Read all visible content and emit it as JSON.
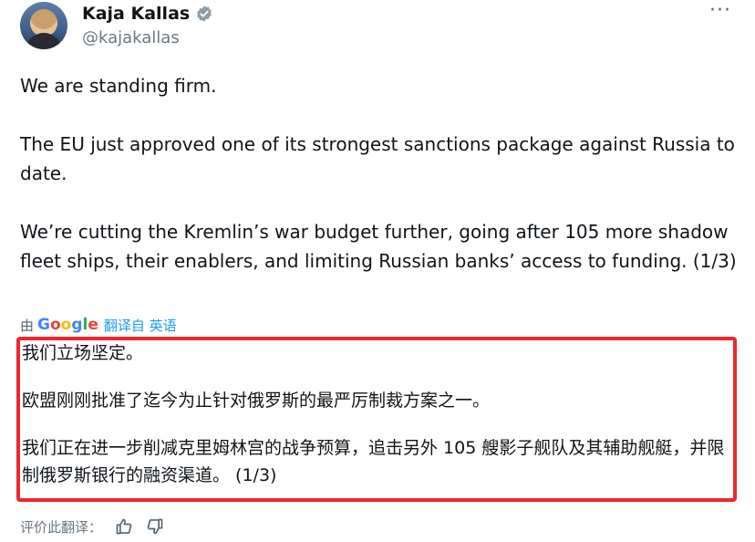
{
  "author": {
    "display_name": "Kaja Kallas",
    "handle": "@kajakallas",
    "avatar_icon": "avatar",
    "verified_icon": "verified-badge-icon"
  },
  "more_menu": {
    "label": "···"
  },
  "tweet": {
    "paragraphs": [
      "We are standing firm.",
      "The EU just approved one of its strongest sanctions package against Russia to date.",
      "We’re cutting the Kremlin’s war budget further, going after 105 more shadow fleet ships, their enablers, and limiting Russian banks’ access to funding. (1/3)"
    ]
  },
  "translation": {
    "prefix": "由",
    "provider": "Google",
    "link_text": "翻译自 英语",
    "paragraphs": [
      "我们立场坚定。",
      "欧盟刚刚批准了迄今为止针对俄罗斯的最严厉制裁方案之一。",
      "我们正在进一步削减克里姆林宫的战争预算，追击另外 105 艘影子舰队及其辅助舰艇，并限制俄罗斯银行的融资渠道。 (1/3)"
    ],
    "highlight_color": "#e8292f"
  },
  "rating": {
    "label": "评价此翻译：",
    "thumbs_up_icon": "thumbs-up-icon",
    "thumbs_down_icon": "thumbs-down-icon"
  },
  "colors": {
    "link": "#1d9bf0",
    "secondary_text": "#536471",
    "primary_text": "#0f1419"
  }
}
